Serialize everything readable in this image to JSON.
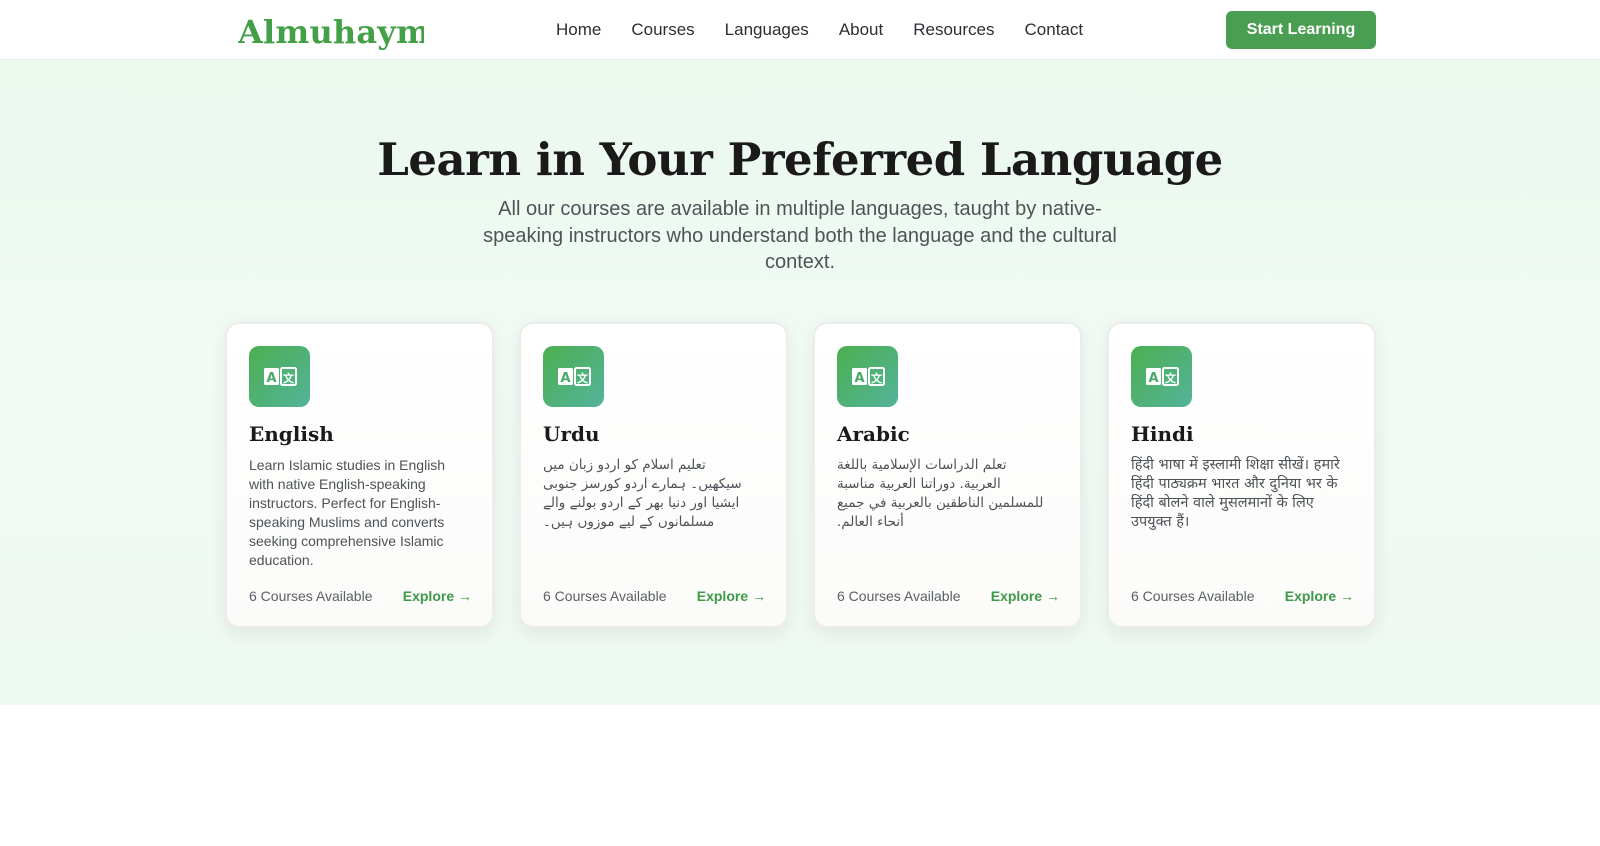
{
  "brand": {
    "name": "Almuhaymin",
    "accent": "#43a047"
  },
  "nav": {
    "links": [
      "Home",
      "Courses",
      "Languages",
      "About",
      "Resources",
      "Contact"
    ],
    "cta_label": "Start Learning"
  },
  "hero": {
    "title": "Learn in Your Preferred Language",
    "subtitle": "All our courses are available in multiple languages, taught by native-speaking instructors who understand both the language and the cultural context."
  },
  "cards": [
    {
      "icon": "translate-icon",
      "title": "English",
      "description": "Learn Islamic studies in English with native English-speaking instructors. Perfect for English-speaking Muslims and converts seeking comprehensive Islamic education.",
      "courses": "6 Courses Available",
      "link": "Explore →"
    },
    {
      "icon": "translate-icon",
      "title": "Urdu",
      "description": "تعلیم اسلام کو اردو زبان میں سیکھیں۔ ہمارے اردو کورسز جنوبی ایشیا اور دنیا بھر کے اردو بولنے والے مسلمانوں کے لیے موزوں ہیں۔",
      "courses": "6 Courses Available",
      "link": "Explore →"
    },
    {
      "icon": "translate-icon",
      "title": "Arabic",
      "description": "تعلم الدراسات الإسلامية باللغة العربية. دوراتنا العربية مناسبة للمسلمين الناطقين بالعربية في جميع أنحاء العالم.",
      "courses": "6 Courses Available",
      "link": "Explore →"
    },
    {
      "icon": "translate-icon",
      "title": "Hindi",
      "description": "हिंदी भाषा में इस्लामी शिक्षा सीखें। हमारे हिंदी पाठ्यक्रम भारत और दुनिया भर के हिंदी बोलने वाले मुसलमानों के लिए उपयुक्त हैं।",
      "courses": "6 Courses Available",
      "link": "Explore →"
    }
  ]
}
